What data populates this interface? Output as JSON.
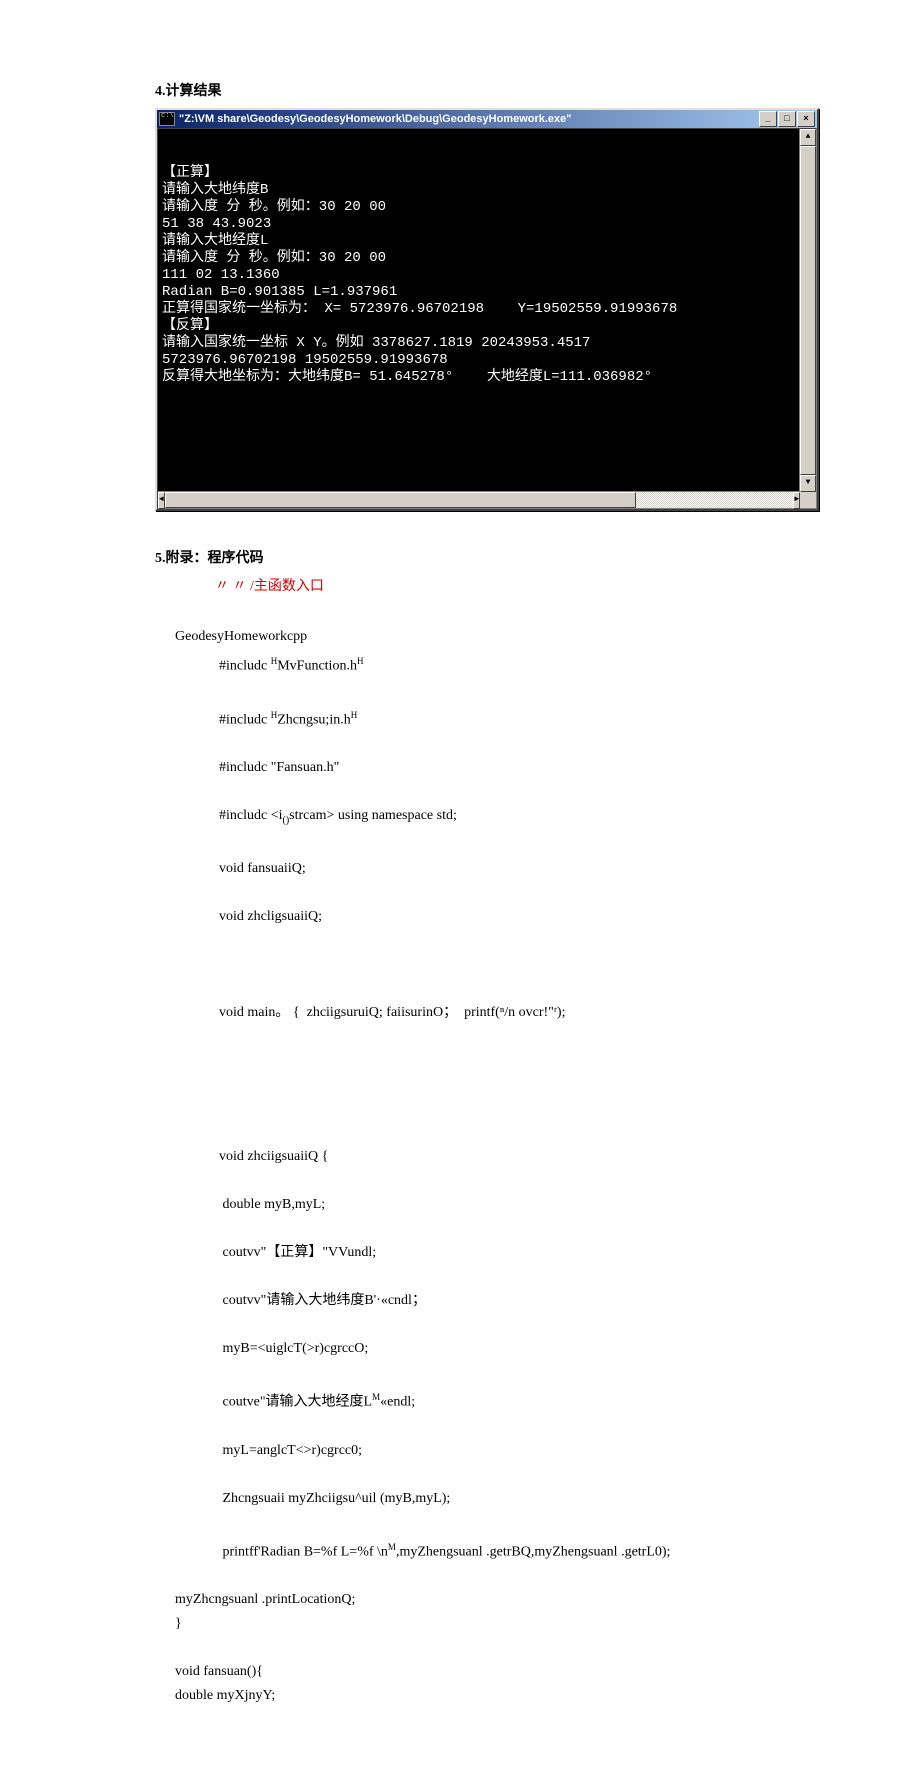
{
  "section4": {
    "heading": "4.计算结果",
    "window_title": "\"Z:\\VM share\\Geodesy\\GeodesyHomework\\Debug\\GeodesyHomework.exe\"",
    "console_lines": [
      "【正算】",
      "请输入大地纬度B",
      "请输入度 分 秒。例如：30 20 00",
      "51 38 43.9023",
      "请输入大地经度L",
      "请输入度 分 秒。例如：30 20 00",
      "111 02 13.1360",
      "Radian B=0.901385 L=1.937961",
      "正算得国家统一坐标为： X= 5723976.96702198    Y=19502559.91993678",
      "【反算】",
      "请输入国家统一坐标 X Y。例如 3378627.1819 20243953.4517",
      "5723976.96702198 19502559.91993678",
      "反算得大地坐标为：大地纬度B= 51.645278°    大地经度L=111.036982°"
    ]
  },
  "section5": {
    "heading": "5.附录：程序代码",
    "comment": "〃 〃 /主函数入口",
    "filename": "GeodesyHomeworkcpp",
    "includes": [
      {
        "pre": "#includc ",
        "supL": "H",
        "mid": "MvFunction.h",
        "supR": "H"
      },
      {
        "pre": "#includc ",
        "supL": "H",
        "mid": "Zhcngsu;in.h",
        "supR": "H"
      },
      {
        "pre": "#includc \"Fansuan.h\"",
        "supL": "",
        "mid": "",
        "supR": ""
      }
    ],
    "include_iostream_pre": "#includc <i",
    "include_iostream_mid": "()",
    "include_iostream_post": "strcam> using namespace std;",
    "decl1": "void fansuaiiQ;",
    "decl2": "void zhcligsuaiiQ;",
    "main_line": "void main。 {  zhciigsuruiQ; faiisurinO；  printf(ⁿ/n ovcr!\"ʳ);",
    "fn_zheng_open": "void zhciigsuaiiQ {",
    "fn_zheng_l1": " double myB,myL;",
    "fn_zheng_l2": " coutvv\"【正算】\"VVundl;",
    "fn_zheng_l3": " coutvv\"请输入大地纬度B'·«cndl；",
    "fn_zheng_l4": " myB=<uiglcT(>r)cgrccO;",
    "fn_zheng_l5_pre": " coutve\"请输入大地经度L",
    "fn_zheng_l5_sup": "M",
    "fn_zheng_l5_post": "«endl;",
    "fn_zheng_l6": " myL=anglcT<>r)cgrcc0;",
    "fn_zheng_l7": " Zhcngsuaii myZhciigsu^uil (myB,myL);",
    "fn_zheng_l8_pre": " printff'Radian B=%f L=%f \\n",
    "fn_zheng_l8_sup": "M",
    "fn_zheng_l8_post": ",myZhengsuanl .getrBQ,myZhengsuanl .getrL0);",
    "fn_zheng_tail1": "myZhcngsuanl .printLocationQ;",
    "fn_zheng_tail2": "}",
    "fn_fan_open": "void fansuan(){",
    "fn_fan_l1": "double myXjnyY;"
  },
  "window_buttons": {
    "minimize": "_",
    "maximize": "□",
    "close": "×",
    "up": "▲",
    "down": "▼",
    "left": "◄",
    "right": "►"
  }
}
